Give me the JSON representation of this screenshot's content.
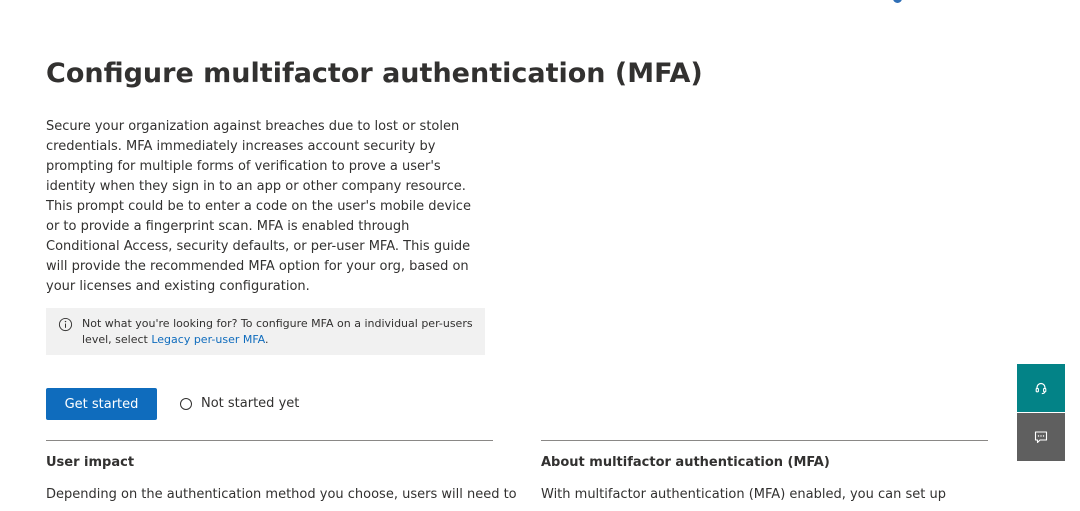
{
  "header": {
    "title": "Configure multifactor authentication (MFA)"
  },
  "intro": {
    "description": "Secure your organization against breaches due to lost or stolen credentials. MFA immediately increases account security by prompting for multiple forms of verification to prove a user's identity when they sign in to an app or other company resource. This prompt could be to enter a code on the user's mobile device or to provide a fingerprint scan. MFA is enabled through Conditional Access, security defaults, or per-user MFA. This guide will provide the recommended MFA option for your org, based on your licenses and existing configuration."
  },
  "info_box": {
    "icon": "info-icon",
    "text": "Not what you're looking for? To configure MFA on a individual per-users level, select ",
    "link_label": "Legacy per-user MFA",
    "suffix": "."
  },
  "actions": {
    "primary_label": "Get started",
    "status_label": "Not started yet"
  },
  "sections": {
    "left": {
      "heading": "User impact",
      "text": "Depending on the authentication method you choose, users will need to"
    },
    "right": {
      "heading": "About multifactor authentication (MFA)",
      "text": "With multifactor authentication (MFA) enabled, you can set up"
    }
  },
  "side_buttons": {
    "help_icon": "headset-icon",
    "feedback_icon": "chat-icon"
  },
  "colors": {
    "primary": "#0f6cbd",
    "help_button": "#038387",
    "feedback_button": "#5f5f5f",
    "info_background": "#f1f1f1",
    "text": "#323130"
  }
}
